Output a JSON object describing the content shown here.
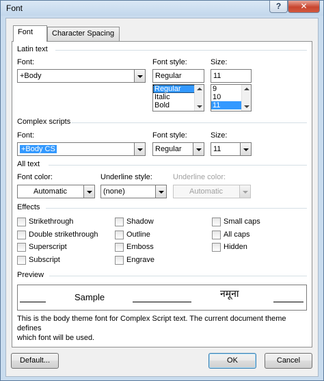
{
  "window": {
    "title": "Font",
    "help_glyph": "?",
    "close_glyph": "✕"
  },
  "tabs": [
    {
      "label": "Font",
      "active": true
    },
    {
      "label": "Character Spacing",
      "active": false
    }
  ],
  "latin": {
    "section_label": "Latin text",
    "font_label": "Font:",
    "font_value": "+Body",
    "style_label": "Font style:",
    "style_value": "Regular",
    "style_options": [
      "Regular",
      "Italic",
      "Bold"
    ],
    "size_label": "Size:",
    "size_value": "11",
    "size_options": [
      "9",
      "10",
      "11"
    ]
  },
  "complex": {
    "section_label": "Complex scripts",
    "font_label": "Font:",
    "font_value": "+Body CS",
    "style_label": "Font style:",
    "style_value": "Regular",
    "size_label": "Size:",
    "size_value": "11"
  },
  "all_text": {
    "section_label": "All text",
    "color_label": "Font color:",
    "color_value": "Automatic",
    "underline_style_label": "Underline style:",
    "underline_style_value": "(none)",
    "underline_color_label": "Underline color:",
    "underline_color_value": "Automatic"
  },
  "effects": {
    "section_label": "Effects",
    "items": [
      {
        "label": "Strikethrough",
        "checked": false
      },
      {
        "label": "Double strikethrough",
        "checked": false
      },
      {
        "label": "Superscript",
        "checked": false
      },
      {
        "label": "Subscript",
        "checked": false
      },
      {
        "label": "Shadow",
        "checked": false
      },
      {
        "label": "Outline",
        "checked": false
      },
      {
        "label": "Emboss",
        "checked": false
      },
      {
        "label": "Engrave",
        "checked": false
      },
      {
        "label": "Small caps",
        "checked": false
      },
      {
        "label": "All caps",
        "checked": false
      },
      {
        "label": "Hidden",
        "checked": false
      }
    ]
  },
  "preview": {
    "section_label": "Preview",
    "sample_text": "Sample",
    "complex_sample_text": "नमूना",
    "note_line1": "This is the body theme font for Complex Script text. The current document theme defines",
    "note_line2": "which font will be used."
  },
  "buttons": {
    "default_label": "Default...",
    "ok_label": "OK",
    "cancel_label": "Cancel"
  }
}
